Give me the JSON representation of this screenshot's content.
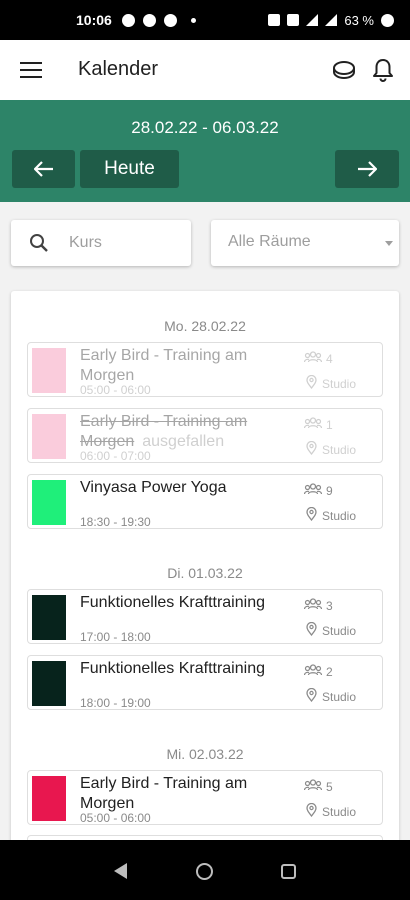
{
  "status_bar": {
    "time": "10:06",
    "battery": "63 %"
  },
  "app_bar": {
    "title": "Kalender"
  },
  "week": {
    "range": "28.02.22 - 06.03.22",
    "today_label": "Heute"
  },
  "filters": {
    "search_placeholder": "Kurs",
    "room_value": "Alle Räume"
  },
  "days": [
    {
      "label": "Mo. 28.02.22",
      "courses": [
        {
          "name": "Early Bird - Training am Morgen",
          "time": "05:00 - 06:00",
          "capacity": "4",
          "room": "Studio",
          "color": "#f48fb1",
          "status": "past"
        },
        {
          "name": "Early Bird - Training am Morgen",
          "cancel_label": "ausgefallen",
          "time": "06:00 - 07:00",
          "capacity": "1",
          "room": "Studio",
          "color": "#f48fb1",
          "status": "cancelled"
        },
        {
          "name": "Vinyasa Power Yoga",
          "time": "18:30 - 19:30",
          "capacity": "9",
          "room": "Studio",
          "color": "#1fef7a",
          "status": "active"
        }
      ]
    },
    {
      "label": "Di. 01.03.22",
      "courses": [
        {
          "name": "Funktionelles Krafttraining",
          "time": "17:00 - 18:00",
          "capacity": "3",
          "room": "Studio",
          "color": "#07231c",
          "status": "active"
        },
        {
          "name": "Funktionelles Krafttraining",
          "time": "18:00 - 19:00",
          "capacity": "2",
          "room": "Studio",
          "color": "#07231c",
          "status": "active"
        }
      ]
    },
    {
      "label": "Mi. 02.03.22",
      "courses": [
        {
          "name": "Early Bird - Training am Morgen",
          "time": "05:00 - 06:00",
          "capacity": "5",
          "room": "Studio",
          "color": "#e8174f",
          "status": "active"
        }
      ]
    }
  ],
  "colors": {
    "primary": "#2d8468",
    "primary_dark": "#1f5c48"
  }
}
